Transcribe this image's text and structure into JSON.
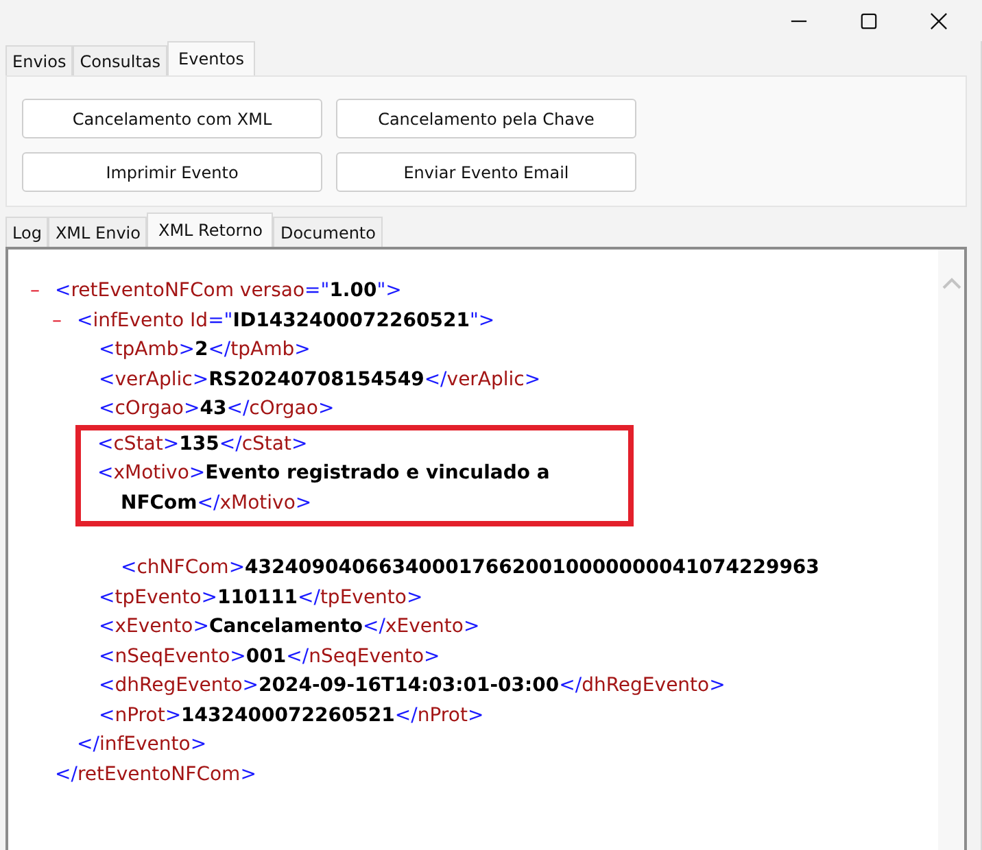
{
  "window": {
    "controls": [
      {
        "kind": "minimize"
      },
      {
        "kind": "maximize"
      },
      {
        "kind": "close"
      }
    ]
  },
  "tabs": [
    {
      "label": "Envios",
      "selected": false
    },
    {
      "label": "Consultas",
      "selected": false
    },
    {
      "label": "Eventos",
      "selected": true
    }
  ],
  "buttons": [
    "Cancelamento com XML",
    "Cancelamento pela Chave",
    "Imprimir Evento",
    "Enviar Evento Email"
  ],
  "result_tabs": [
    {
      "label": "Log",
      "selected": false
    },
    {
      "label": "XML Envio",
      "selected": false
    },
    {
      "label": "XML Retorno",
      "selected": true
    },
    {
      "label": "Documento",
      "selected": false
    }
  ],
  "xml": {
    "toggle": "–",
    "open": [
      {
        "kind": "punct",
        "text": "<"
      },
      {
        "kind": "name",
        "text": "retEventoNFCom versao"
      },
      {
        "kind": "punct",
        "text": "=\""
      },
      {
        "kind": "value",
        "text": "1.00"
      },
      {
        "kind": "punct",
        "text": "\">"
      }
    ],
    "close": [
      {
        "kind": "punct",
        "text": "</"
      },
      {
        "kind": "name",
        "text": "retEventoNFCom"
      },
      {
        "kind": "punct",
        "text": ">"
      }
    ],
    "children": [
      {
        "toggle": "–",
        "open": [
          {
            "kind": "punct",
            "text": "<"
          },
          {
            "kind": "name",
            "text": "infEvento Id"
          },
          {
            "kind": "punct",
            "text": "=\""
          },
          {
            "kind": "value",
            "text": "ID1432400072260521"
          },
          {
            "kind": "punct",
            "text": "\">"
          }
        ],
        "close": [
          {
            "kind": "punct",
            "text": "</"
          },
          {
            "kind": "name",
            "text": "infEvento"
          },
          {
            "kind": "punct",
            "text": ">"
          }
        ],
        "children": [
          {
            "open": [
              {
                "kind": "punct",
                "text": "<"
              },
              {
                "kind": "name",
                "text": "tpAmb"
              },
              {
                "kind": "punct",
                "text": ">"
              }
            ],
            "value": "2",
            "close": [
              {
                "kind": "punct",
                "text": "</"
              },
              {
                "kind": "name",
                "text": "tpAmb"
              },
              {
                "kind": "punct",
                "text": ">"
              }
            ]
          },
          {
            "open": [
              {
                "kind": "punct",
                "text": "<"
              },
              {
                "kind": "name",
                "text": "verAplic"
              },
              {
                "kind": "punct",
                "text": ">"
              }
            ],
            "value": "RS20240708154549",
            "close": [
              {
                "kind": "punct",
                "text": "</"
              },
              {
                "kind": "name",
                "text": "verAplic"
              },
              {
                "kind": "punct",
                "text": ">"
              }
            ]
          },
          {
            "open": [
              {
                "kind": "punct",
                "text": "<"
              },
              {
                "kind": "name",
                "text": "cOrgao"
              },
              {
                "kind": "punct",
                "text": ">"
              }
            ],
            "value": "43",
            "close": [
              {
                "kind": "punct",
                "text": "</"
              },
              {
                "kind": "name",
                "text": "cOrgao"
              },
              {
                "kind": "punct",
                "text": ">"
              }
            ]
          },
          {
            "kind": "highlight",
            "children": [
              {
                "open": [
                  {
                    "kind": "punct",
                    "text": "<"
                  },
                  {
                    "kind": "name",
                    "text": "cStat"
                  },
                  {
                    "kind": "punct",
                    "text": ">"
                  }
                ],
                "value": "135",
                "close": [
                  {
                    "kind": "punct",
                    "text": "</"
                  },
                  {
                    "kind": "name",
                    "text": "cStat"
                  },
                  {
                    "kind": "punct",
                    "text": ">"
                  }
                ]
              },
              {
                "open": [
                  {
                    "kind": "punct",
                    "text": "<"
                  },
                  {
                    "kind": "name",
                    "text": "xMotivo"
                  },
                  {
                    "kind": "punct",
                    "text": ">"
                  }
                ],
                "value": "Evento registrado e vinculado a NFCom",
                "close": [
                  {
                    "kind": "punct",
                    "text": "</"
                  },
                  {
                    "kind": "name",
                    "text": "xMotivo"
                  },
                  {
                    "kind": "punct",
                    "text": ">"
                  }
                ]
              }
            ]
          },
          {
            "kind": "indented",
            "children": [
              {
                "open": [
                  {
                    "kind": "punct",
                    "text": "<"
                  },
                  {
                    "kind": "name",
                    "text": "chNFCom"
                  },
                  {
                    "kind": "punct",
                    "text": ">"
                  }
                ],
                "value": "4324090406634000176620010000000041074229963"
              }
            ]
          },
          {
            "open": [
              {
                "kind": "punct",
                "text": "<"
              },
              {
                "kind": "name",
                "text": "tpEvento"
              },
              {
                "kind": "punct",
                "text": ">"
              }
            ],
            "value": "110111",
            "close": [
              {
                "kind": "punct",
                "text": "</"
              },
              {
                "kind": "name",
                "text": "tpEvento"
              },
              {
                "kind": "punct",
                "text": ">"
              }
            ]
          },
          {
            "open": [
              {
                "kind": "punct",
                "text": "<"
              },
              {
                "kind": "name",
                "text": "xEvento"
              },
              {
                "kind": "punct",
                "text": ">"
              }
            ],
            "value": "Cancelamento",
            "close": [
              {
                "kind": "punct",
                "text": "</"
              },
              {
                "kind": "name",
                "text": "xEvento"
              },
              {
                "kind": "punct",
                "text": ">"
              }
            ]
          },
          {
            "open": [
              {
                "kind": "punct",
                "text": "<"
              },
              {
                "kind": "name",
                "text": "nSeqEvento"
              },
              {
                "kind": "punct",
                "text": ">"
              }
            ],
            "value": "001",
            "close": [
              {
                "kind": "punct",
                "text": "</"
              },
              {
                "kind": "name",
                "text": "nSeqEvento"
              },
              {
                "kind": "punct",
                "text": ">"
              }
            ]
          },
          {
            "open": [
              {
                "kind": "punct",
                "text": "<"
              },
              {
                "kind": "name",
                "text": "dhRegEvento"
              },
              {
                "kind": "punct",
                "text": ">"
              }
            ],
            "value": "2024-09-16T14:03:01-03:00",
            "close": [
              {
                "kind": "punct",
                "text": "</"
              },
              {
                "kind": "name",
                "text": "dhRegEvento"
              },
              {
                "kind": "punct",
                "text": ">"
              }
            ]
          },
          {
            "open": [
              {
                "kind": "punct",
                "text": "<"
              },
              {
                "kind": "name",
                "text": "nProt"
              },
              {
                "kind": "punct",
                "text": ">"
              }
            ],
            "value": "1432400072260521",
            "close": [
              {
                "kind": "punct",
                "text": "</"
              },
              {
                "kind": "name",
                "text": "nProt"
              },
              {
                "kind": "punct",
                "text": ">"
              }
            ]
          }
        ]
      }
    ]
  }
}
